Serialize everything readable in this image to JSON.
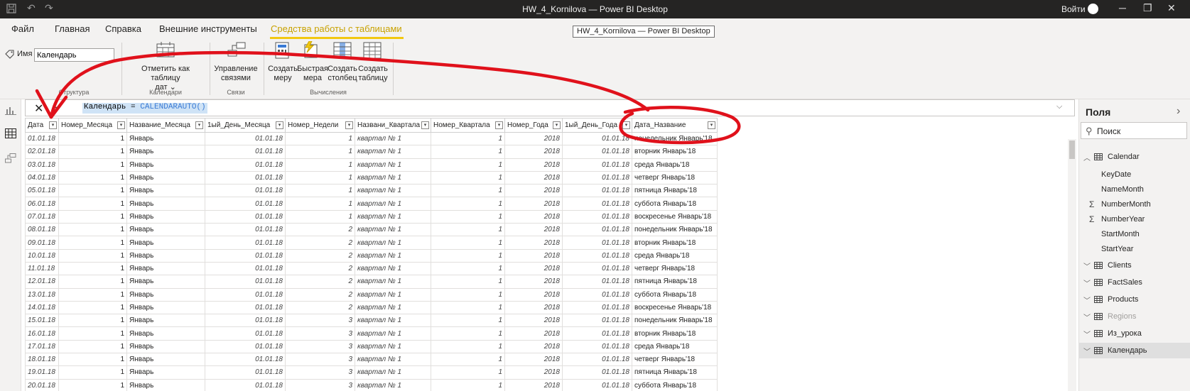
{
  "window": {
    "title": "HW_4_Kornilova — Power BI Desktop",
    "signin": "Войти"
  },
  "menu_tabs": [
    "Файл",
    "Главная",
    "Справка",
    "Внешние инструменты",
    "Средства работы с таблицами"
  ],
  "tooltip": "HW_4_Kornilova — Power BI Desktop",
  "ribbon": {
    "name_label": "Имя",
    "name_value": "Календарь",
    "mark_date_table_line1": "Отметить как таблицу",
    "mark_date_table_line2": "дат",
    "manage_relations_line1": "Управление",
    "manage_relations_line2": "связями",
    "new_measure_line1": "Создать",
    "new_measure_line2": "меру",
    "quick_measure_line1": "Быстрая",
    "quick_measure_line2": "мера",
    "new_column_line1": "Создать",
    "new_column_line2": "столбец",
    "new_table_line1": "Создать",
    "new_table_line2": "таблицу",
    "groups": {
      "structure": "Структура",
      "calendars": "Календари",
      "relations": "Связи",
      "calculations": "Вычисления"
    }
  },
  "formula": {
    "part1": "Календарь = ",
    "part2": "CALENDARAUTO()"
  },
  "columns": [
    "Дата",
    "Номер_Месяца",
    "Название_Месяца",
    "1ый_День_Месяца",
    "Номер_Недели",
    "Названи_Квартала",
    "Номер_Квартала",
    "Номер_Года",
    "1ый_День_Года",
    "Дата_Название"
  ],
  "rows": [
    [
      "01.01.18",
      "1",
      "Январь",
      "01.01.18",
      "1",
      "квартал № 1",
      "1",
      "2018",
      "01.01.18",
      "понедельник Январь'18"
    ],
    [
      "02.01.18",
      "1",
      "Январь",
      "01.01.18",
      "1",
      "квартал № 1",
      "1",
      "2018",
      "01.01.18",
      "вторник Январь'18"
    ],
    [
      "03.01.18",
      "1",
      "Январь",
      "01.01.18",
      "1",
      "квартал № 1",
      "1",
      "2018",
      "01.01.18",
      "среда Январь'18"
    ],
    [
      "04.01.18",
      "1",
      "Январь",
      "01.01.18",
      "1",
      "квартал № 1",
      "1",
      "2018",
      "01.01.18",
      "четверг Январь'18"
    ],
    [
      "05.01.18",
      "1",
      "Январь",
      "01.01.18",
      "1",
      "квартал № 1",
      "1",
      "2018",
      "01.01.18",
      "пятница Январь'18"
    ],
    [
      "06.01.18",
      "1",
      "Январь",
      "01.01.18",
      "1",
      "квартал № 1",
      "1",
      "2018",
      "01.01.18",
      "суббота Январь'18"
    ],
    [
      "07.01.18",
      "1",
      "Январь",
      "01.01.18",
      "1",
      "квартал № 1",
      "1",
      "2018",
      "01.01.18",
      "воскресенье Январь'18"
    ],
    [
      "08.01.18",
      "1",
      "Январь",
      "01.01.18",
      "2",
      "квартал № 1",
      "1",
      "2018",
      "01.01.18",
      "понедельник Январь'18"
    ],
    [
      "09.01.18",
      "1",
      "Январь",
      "01.01.18",
      "2",
      "квартал № 1",
      "1",
      "2018",
      "01.01.18",
      "вторник Январь'18"
    ],
    [
      "10.01.18",
      "1",
      "Январь",
      "01.01.18",
      "2",
      "квартал № 1",
      "1",
      "2018",
      "01.01.18",
      "среда Январь'18"
    ],
    [
      "11.01.18",
      "1",
      "Январь",
      "01.01.18",
      "2",
      "квартал № 1",
      "1",
      "2018",
      "01.01.18",
      "четверг Январь'18"
    ],
    [
      "12.01.18",
      "1",
      "Январь",
      "01.01.18",
      "2",
      "квартал № 1",
      "1",
      "2018",
      "01.01.18",
      "пятница Январь'18"
    ],
    [
      "13.01.18",
      "1",
      "Январь",
      "01.01.18",
      "2",
      "квартал № 1",
      "1",
      "2018",
      "01.01.18",
      "суббота Январь'18"
    ],
    [
      "14.01.18",
      "1",
      "Январь",
      "01.01.18",
      "2",
      "квартал № 1",
      "1",
      "2018",
      "01.01.18",
      "воскресенье Январь'18"
    ],
    [
      "15.01.18",
      "1",
      "Январь",
      "01.01.18",
      "3",
      "квартал № 1",
      "1",
      "2018",
      "01.01.18",
      "понедельник Январь'18"
    ],
    [
      "16.01.18",
      "1",
      "Январь",
      "01.01.18",
      "3",
      "квартал № 1",
      "1",
      "2018",
      "01.01.18",
      "вторник Январь'18"
    ],
    [
      "17.01.18",
      "1",
      "Январь",
      "01.01.18",
      "3",
      "квартал № 1",
      "1",
      "2018",
      "01.01.18",
      "среда Январь'18"
    ],
    [
      "18.01.18",
      "1",
      "Январь",
      "01.01.18",
      "3",
      "квартал № 1",
      "1",
      "2018",
      "01.01.18",
      "четверг Январь'18"
    ],
    [
      "19.01.18",
      "1",
      "Январь",
      "01.01.18",
      "3",
      "квартал № 1",
      "1",
      "2018",
      "01.01.18",
      "пятница Январь'18"
    ],
    [
      "20.01.18",
      "1",
      "Январь",
      "01.01.18",
      "3",
      "квартал № 1",
      "1",
      "2018",
      "01.01.18",
      "суббота Январь'18"
    ]
  ],
  "fields_pane": {
    "title": "Поля",
    "search_placeholder": "Поиск",
    "calendar_table": "Calendar",
    "calendar_fields": [
      {
        "name": "KeyDate",
        "sigma": false
      },
      {
        "name": "NameMonth",
        "sigma": false
      },
      {
        "name": "NumberMonth",
        "sigma": true
      },
      {
        "name": "NumberYear",
        "sigma": true
      },
      {
        "name": "StartMonth",
        "sigma": false
      },
      {
        "name": "StartYear",
        "sigma": false
      }
    ],
    "other_tables": [
      "Clients",
      "FactSales",
      "Products",
      "Regions",
      "Из_урока",
      "Календарь"
    ]
  },
  "colors": {
    "accent": "#f2c811",
    "titlebar": "#252423",
    "annotation_red": "#e0111b"
  },
  "icons": {
    "save": "save-icon",
    "undo": "undo-icon",
    "redo": "redo-icon",
    "search": "search-icon",
    "table": "table-icon",
    "sigma": "sigma-icon"
  }
}
